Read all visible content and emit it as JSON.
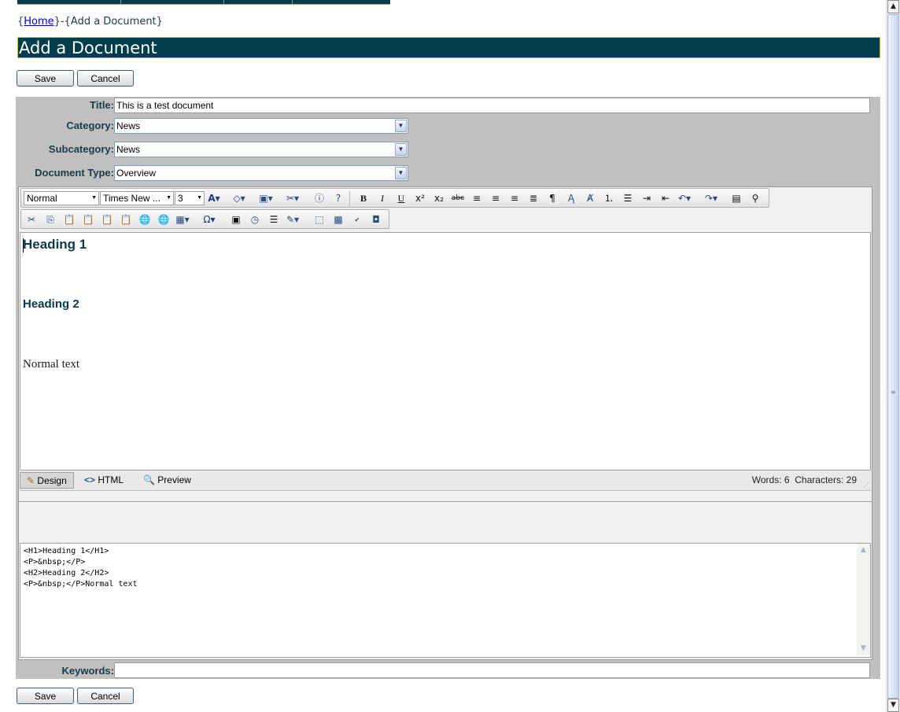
{
  "breadcrumb": {
    "open_brace": "{",
    "home": "Home",
    "middle": "}-{",
    "current": "Add a Document",
    "close_brace": "}"
  },
  "page_title": "Add a Document",
  "buttons": {
    "save": "Save",
    "cancel": "Cancel"
  },
  "form": {
    "title_label": "Title:",
    "title_value": "This is a test document",
    "category_label": "Category:",
    "category_value": "News",
    "subcategory_label": "Subcategory:",
    "subcategory_value": "News",
    "doctype_label": "Document Type:",
    "doctype_value": "Overview",
    "keywords_label": "Keywords:",
    "keywords_value": ""
  },
  "editor": {
    "toolbar": {
      "paragraph_format": "Normal",
      "font_name": "Times New ...",
      "font_size": "3"
    },
    "content": {
      "heading1": "Heading 1",
      "heading2": "Heading 2",
      "normal_text": "Normal text"
    },
    "modes": {
      "design": "Design",
      "html": "HTML",
      "preview": "Preview"
    },
    "stats": {
      "words_label": "Words:",
      "words": "6",
      "chars_label": "Characters:",
      "chars": "29"
    },
    "source": "<H1>Heading 1</H1>\n<P>&nbsp;</P>\n<H2>Heading 2</H2>\n<P>&nbsp;</P>Normal text"
  },
  "colors": {
    "header_bg": "#003d4c",
    "panel_bg": "#c0c0c0",
    "label_text": "#1a3a4a",
    "link": "#0000cc"
  },
  "icons": [
    "pencil-icon",
    "code-icon",
    "magnifier-icon",
    "bold-icon",
    "italic-icon",
    "underline-icon",
    "cut-icon",
    "copy-icon",
    "paste-icon",
    "table-icon",
    "omega-icon",
    "clock-icon",
    "spellcheck-icon"
  ]
}
